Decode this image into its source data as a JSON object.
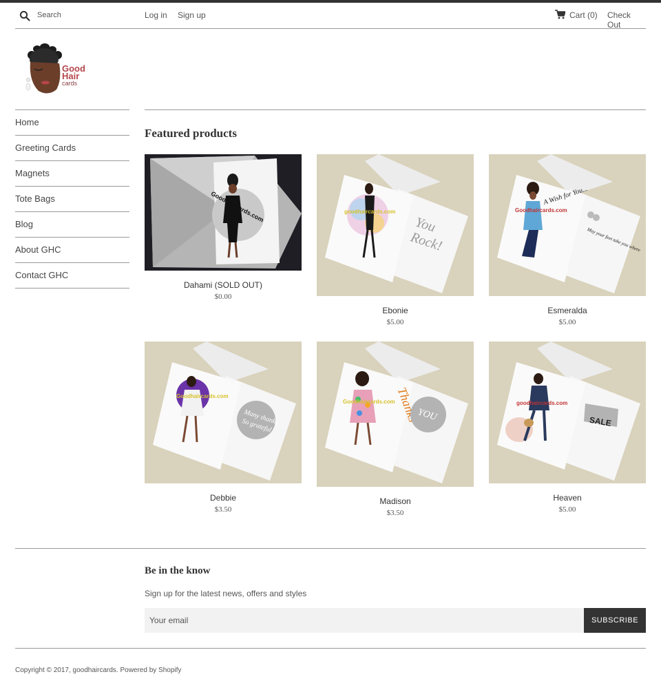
{
  "header": {
    "search_placeholder": "Search",
    "login": "Log in",
    "signup": "Sign up",
    "cart": "Cart (0)",
    "checkout": "Check Out"
  },
  "logo": {
    "line1": "Good",
    "line2": "Hair",
    "line3": "cards"
  },
  "sidebar": {
    "items": [
      {
        "label": "Home"
      },
      {
        "label": "Greeting Cards"
      },
      {
        "label": "Magnets"
      },
      {
        "label": "Tote Bags"
      },
      {
        "label": "Blog"
      },
      {
        "label": "About GHC"
      },
      {
        "label": "Contact GHC"
      }
    ]
  },
  "main": {
    "title": "Featured products",
    "products": [
      {
        "name": "Dahami (SOLD OUT)",
        "price": "$0.00"
      },
      {
        "name": "Ebonie",
        "price": "$5.00"
      },
      {
        "name": "Esmeralda",
        "price": "$5.00"
      },
      {
        "name": "Debbie",
        "price": "$3.50"
      },
      {
        "name": "Madison",
        "price": "$3.50"
      },
      {
        "name": "Heaven",
        "price": "$5.00"
      }
    ]
  },
  "newsletter": {
    "title": "Be in the know",
    "text": "Sign up for the latest news, offers and styles",
    "placeholder": "Your email",
    "button": "SUBSCRIBE"
  },
  "footer": {
    "copyright": "Copyright © 2017, goodhaircards. Powered by Shopify"
  }
}
